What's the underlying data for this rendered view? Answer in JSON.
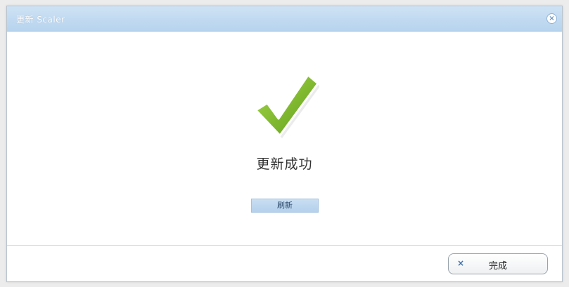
{
  "dialog": {
    "title": "更新 Scaler",
    "close_icon": "close-icon",
    "close_glyph": "×"
  },
  "content": {
    "check_icon": "checkmark-icon",
    "status": "更新成功",
    "refresh_label": "刷新"
  },
  "footer": {
    "done_icon": "x-icon",
    "done_glyph": "×",
    "done_label": "完成"
  },
  "colors": {
    "titlebar": "#b6d3ee",
    "check_green": "#7cbb2a",
    "refresh_button": "#b3d0ec"
  }
}
